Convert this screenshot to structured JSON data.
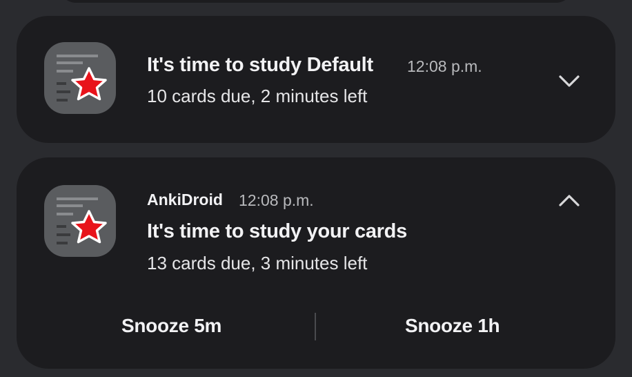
{
  "notifications": [
    {
      "title": "It's time to study Default",
      "time": "12:08 p.m.",
      "text": "10 cards due, 2 minutes left",
      "icon": "ankidroid-app-icon",
      "toggle_icon": "chevron-down-icon"
    },
    {
      "app_name": "AnkiDroid",
      "time": "12:08 p.m.",
      "title": "It's time to study your cards",
      "text": "13 cards due, 3 minutes left",
      "icon": "ankidroid-app-icon",
      "toggle_icon": "chevron-up-icon",
      "actions": [
        "Snooze 5m",
        "Snooze 1h"
      ]
    }
  ],
  "colors": {
    "background": "#2a2b2f",
    "card": "#1c1c1f",
    "icon_bg": "#5a5c5f",
    "star": "#e8131b",
    "text_primary": "#f2f2f4",
    "text_secondary": "#b9babd"
  }
}
